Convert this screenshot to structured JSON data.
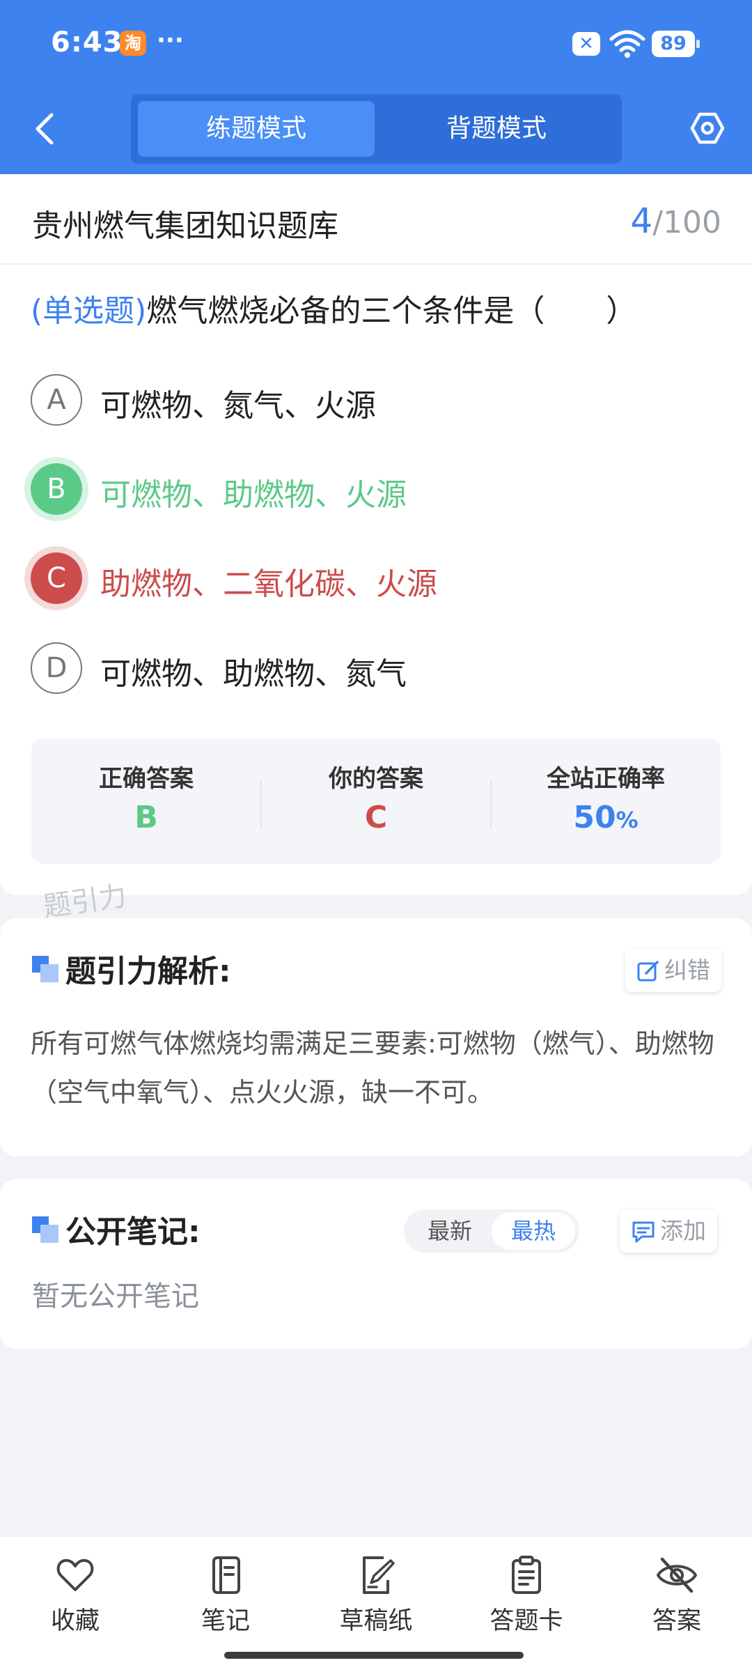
{
  "status_bar": {
    "time": "6:43",
    "app_badge": "淘",
    "more_dots": "···",
    "x_badge": "✕",
    "battery": "89"
  },
  "header": {
    "modes": [
      "练题模式",
      "背题模式"
    ],
    "active_mode": "练题模式"
  },
  "question_card": {
    "bank_title": "贵州燃气集团知识题库",
    "progress_current": "4",
    "progress_total": "/100",
    "question_type": "(单选题)",
    "question_text": "燃气燃烧必备的三个条件是（　　）",
    "options": [
      {
        "letter": "A",
        "text": "可燃物、氮气、火源",
        "state": "normal"
      },
      {
        "letter": "B",
        "text": "可燃物、助燃物、火源",
        "state": "correct"
      },
      {
        "letter": "C",
        "text": "助燃物、二氧化碳、火源",
        "state": "wrong"
      },
      {
        "letter": "D",
        "text": "可燃物、助燃物、氮气",
        "state": "normal"
      }
    ],
    "stats": {
      "correct_label": "正确答案",
      "correct_value": "B",
      "yours_label": "你的答案",
      "yours_value": "C",
      "rate_label": "全站正确率",
      "rate_value": "50",
      "rate_unit": "%"
    },
    "watermark": "题引力"
  },
  "analysis": {
    "title": "题引力解析:",
    "report_label": "纠错",
    "text": "所有可燃气体燃烧均需满足三要素:可燃物（燃气）、助燃物（空气中氧气）、点火火源，缺一不可。"
  },
  "notes": {
    "title": "公开笔记:",
    "sort_newest": "最新",
    "sort_hottest": "最热",
    "add_label": "添加",
    "empty_text": "暂无公开笔记"
  },
  "toolbar": {
    "items": [
      "收藏",
      "笔记",
      "草稿纸",
      "答题卡",
      "答案"
    ]
  },
  "colors": {
    "primary": "#3e82f0",
    "correct": "#5bc987",
    "wrong": "#cc4c4c"
  }
}
